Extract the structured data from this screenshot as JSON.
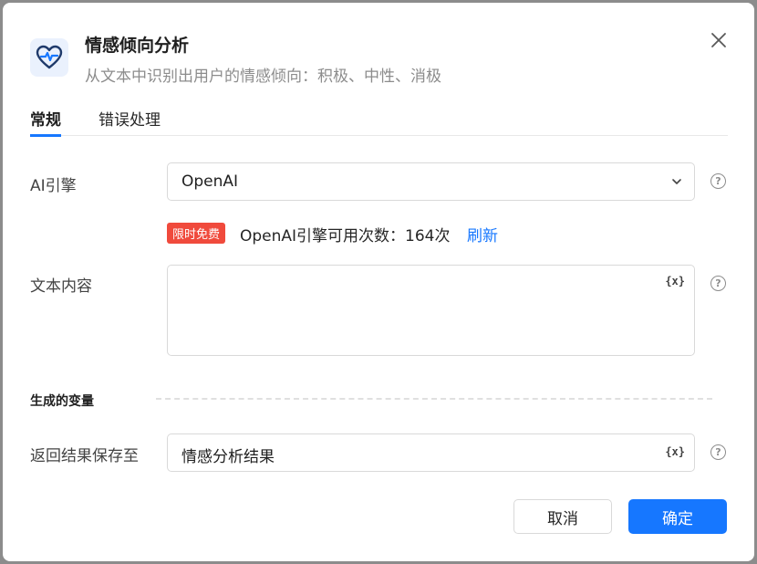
{
  "dialog": {
    "title": "情感倾向分析",
    "subtitle": "从文本中识别出用户的情感倾向：积极、中性、消极"
  },
  "icons": {
    "app": "heart-pulse-icon",
    "close": "close-icon",
    "help": "question-circle-icon",
    "chevron": "chevron-down-icon"
  },
  "tabs": [
    {
      "label": "常规",
      "active": true
    },
    {
      "label": "错误处理",
      "active": false
    }
  ],
  "form": {
    "engine": {
      "label": "AI引擎",
      "value": "OpenAI"
    },
    "promo": {
      "badge": "限时免费",
      "quota_text": "OpenAI引擎可用次数：164次",
      "refresh_label": "刷新"
    },
    "text_content": {
      "label": "文本内容",
      "value": "",
      "var_button": "{x}"
    },
    "help_glyph": "?"
  },
  "output": {
    "section_title": "生成的变量",
    "save_to": {
      "label": "返回结果保存至",
      "value": "情感分析结果",
      "var_button": "{x}"
    }
  },
  "footer": {
    "cancel_label": "取消",
    "confirm_label": "确定"
  },
  "colors": {
    "accent": "#1677ff",
    "badge": "#f04a3c",
    "overlay": "#8c8c8c"
  }
}
